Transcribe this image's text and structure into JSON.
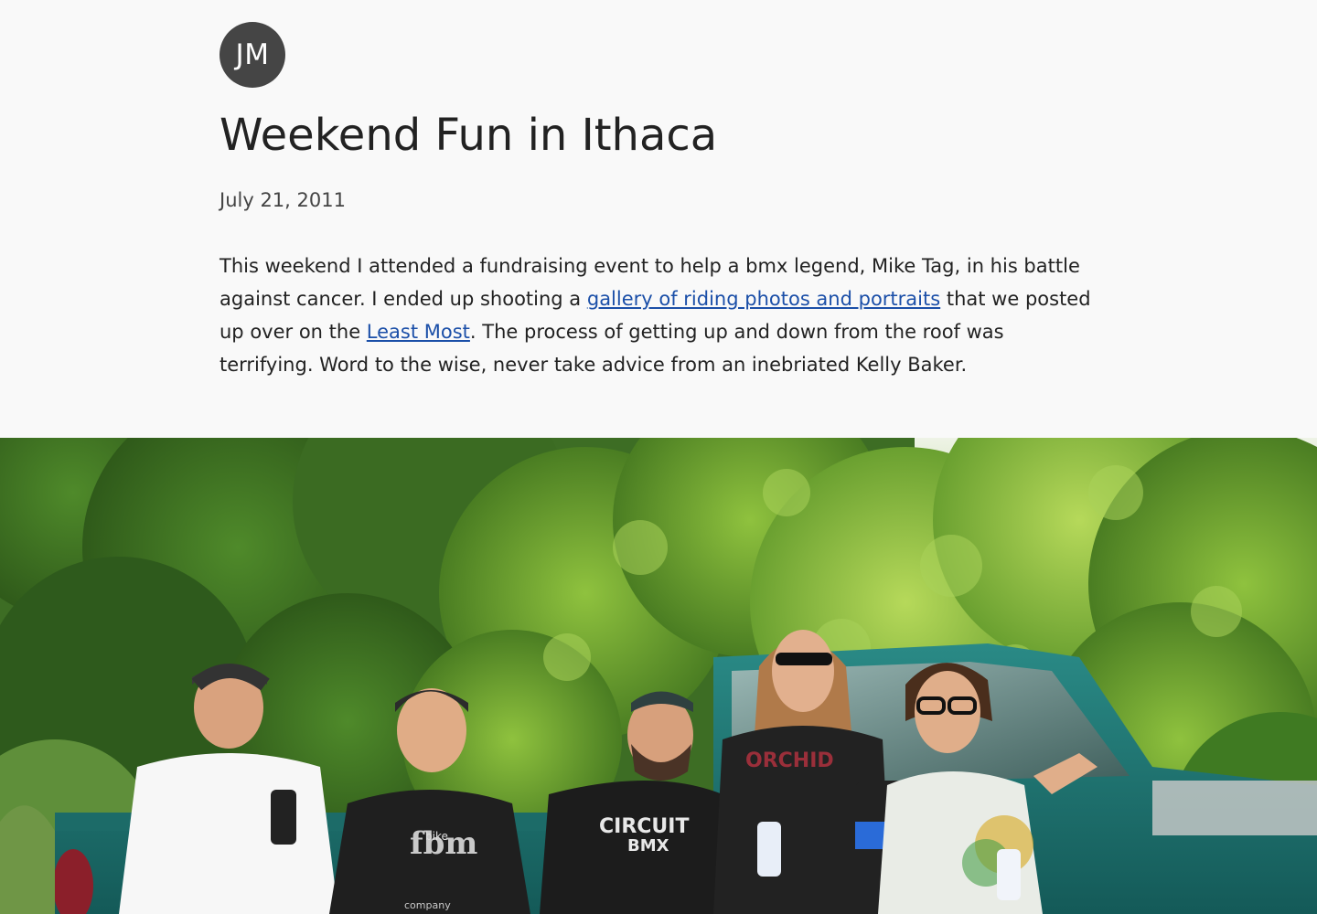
{
  "header": {
    "avatar_initials": "JM",
    "title": "Weekend Fun in Ithaca",
    "date": "July 21, 2011"
  },
  "post": {
    "text_1": "This weekend I attended a fundraising event to help a bmx legend, Mike Tag, in his battle against cancer. I ended up shooting a ",
    "link_gallery": "gallery of riding photos and portraits",
    "text_2": " that we posted up over on the ",
    "link_least_most": "Least Most",
    "text_3": ". The process of getting up and down from the roof was terrifying. Word to the wise, never take advice from an inebriated Kelly Baker."
  },
  "photo": {
    "description_icon": "group-photo",
    "shirt_text_circuit": "CIRCUIT",
    "shirt_text_bmx": "BMX",
    "shirt_text_bike": "bike",
    "shirt_text_fbm": "fbm",
    "shirt_text_company": "company",
    "shirt_text_orchid": "ORCHID"
  },
  "colors": {
    "background": "#f9f9f9",
    "avatar": "#454545",
    "link": "#1b4fa8",
    "text": "#222222"
  }
}
